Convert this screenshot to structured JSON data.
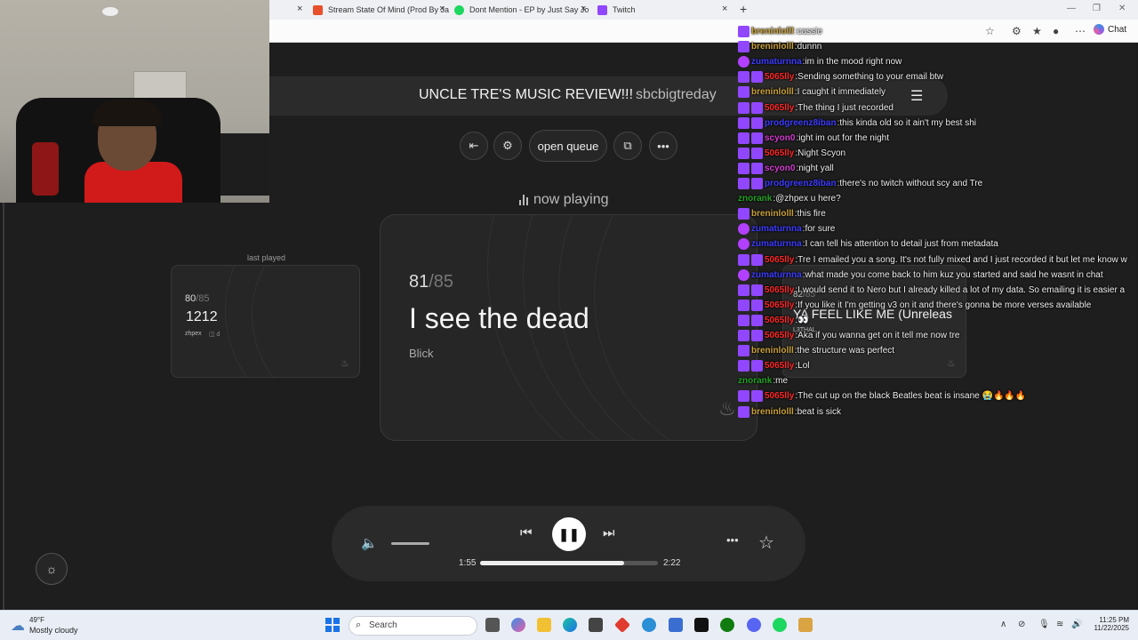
{
  "browser": {
    "tabs": [
      {
        "title": "Stream State Of Mind (Prod By Ja",
        "color": "#e8502b"
      },
      {
        "title": "Dont Mention - EP by Just Say Jo",
        "color": "#1ed760"
      },
      {
        "title": "Twitch",
        "color": "#9147ff"
      }
    ],
    "tab_close": "×",
    "new_tab": "+",
    "chat_button": "Chat"
  },
  "header": {
    "title": "UNCLE TRE'S MUSIC REVIEW!!!",
    "separator": "·",
    "username": "sbcbigtreday"
  },
  "toolbar": {
    "open_queue": "open queue"
  },
  "now_playing_label": "now playing",
  "last_played": {
    "label": "last played",
    "position": "80",
    "total": "/85",
    "title": "1212",
    "artist": "zhpex",
    "extra": "◫ d"
  },
  "current": {
    "position": "81",
    "total": "/85",
    "title": "I see the dead",
    "artist": "Blick"
  },
  "next": {
    "position": "82",
    "total": "/85",
    "title": "YA FEEL LIKE ME (Unreleas",
    "artist": "L3THAL"
  },
  "player": {
    "current_time": "1:55",
    "total_time": "2:22",
    "progress": 0.81
  },
  "chat": {
    "messages": [
      {
        "badges": [
          "star"
        ],
        "user": "breninlolll",
        "color": "#c9a13a",
        "text": "cassie"
      },
      {
        "badges": [
          "star"
        ],
        "user": "breninlolll",
        "color": "#c9a13a",
        "text": "dunnn"
      },
      {
        "badges": [
          "heart"
        ],
        "user": "zumaturnna",
        "color": "#3c3cff",
        "text": "im in the mood right now"
      },
      {
        "badges": [
          "star",
          "vid"
        ],
        "user": "5065lly",
        "color": "#ff2828",
        "text": "Sending something to your email btw"
      },
      {
        "badges": [
          "star"
        ],
        "user": "breninlolll",
        "color": "#c9a13a",
        "text": "I caught it immediately"
      },
      {
        "badges": [
          "star",
          "vid"
        ],
        "user": "5065lly",
        "color": "#ff2828",
        "text": "The thing I just recorded"
      },
      {
        "badges": [
          "star",
          "vid"
        ],
        "user": "prodgreenz8iban",
        "color": "#3c3cff",
        "text": "this kinda old so it ain't my best shi"
      },
      {
        "badges": [
          "star",
          "vid"
        ],
        "user": "scyon0",
        "color": "#d33cd0",
        "text": "ight im out for the night"
      },
      {
        "badges": [
          "star",
          "vid"
        ],
        "user": "5065lly",
        "color": "#ff2828",
        "text": "Night Scyon"
      },
      {
        "badges": [
          "star",
          "vid"
        ],
        "user": "scyon0",
        "color": "#d33cd0",
        "text": "night yall"
      },
      {
        "badges": [
          "star",
          "vid"
        ],
        "user": "prodgreenz8iban",
        "color": "#3c3cff",
        "text": "there's no twitch without scy and Tre"
      },
      {
        "badges": [],
        "user": "znorank",
        "color": "#23a323",
        "text": "@zhpex u here?"
      },
      {
        "badges": [
          "star"
        ],
        "user": "breninlolll",
        "color": "#c9a13a",
        "text": "this fire"
      },
      {
        "badges": [
          "heart"
        ],
        "user": "zumaturnna",
        "color": "#3c3cff",
        "text": "for sure"
      },
      {
        "badges": [
          "heart"
        ],
        "user": "zumaturnna",
        "color": "#3c3cff",
        "text": "I can tell his attention to detail just from metadata"
      },
      {
        "badges": [
          "star",
          "vid"
        ],
        "user": "5065lly",
        "color": "#ff2828",
        "text": "Tre I emailed you a song. It's not fully mixed and I just recorded it but let me know w"
      },
      {
        "badges": [
          "heart"
        ],
        "user": "zumaturnna",
        "color": "#3c3cff",
        "text": "what made you come back to him kuz you started and said he wasnt in chat"
      },
      {
        "badges": [
          "star",
          "vid"
        ],
        "user": "5065lly",
        "color": "#ff2828",
        "text": "I would send it to Nero but I already killed a lot of my data. So emailing it is easier a"
      },
      {
        "badges": [
          "star",
          "vid"
        ],
        "user": "5065lly",
        "color": "#ff2828",
        "text": "If you like it I'm getting v3 on it and there's gonna be more verses available"
      },
      {
        "badges": [
          "star",
          "vid"
        ],
        "user": "5065lly",
        "color": "#ff2828",
        "text": "👀"
      },
      {
        "badges": [
          "star",
          "vid"
        ],
        "user": "5065lly",
        "color": "#ff2828",
        "text": "Aka if you wanna get on it tell me now tre"
      },
      {
        "badges": [
          "star"
        ],
        "user": "breninlolll",
        "color": "#c9a13a",
        "text": "the structure was perfect"
      },
      {
        "badges": [
          "star",
          "vid"
        ],
        "user": "5065lly",
        "color": "#ff2828",
        "text": "Lol"
      },
      {
        "badges": [],
        "user": "znorank",
        "color": "#23a323",
        "text": "me"
      },
      {
        "badges": [
          "star",
          "vid"
        ],
        "user": "5065lly",
        "color": "#ff2828",
        "text": "The cut up on the black Beatles beat is insane 😭🔥🔥🔥"
      },
      {
        "badges": [
          "star"
        ],
        "user": "breninlolll",
        "color": "#c9a13a",
        "text": "beat is sick"
      }
    ]
  },
  "taskbar": {
    "temperature": "49°F",
    "weather": "Mostly cloudy",
    "search_placeholder": "Search",
    "time": "11:25 PM",
    "date": "11/22/2025"
  }
}
